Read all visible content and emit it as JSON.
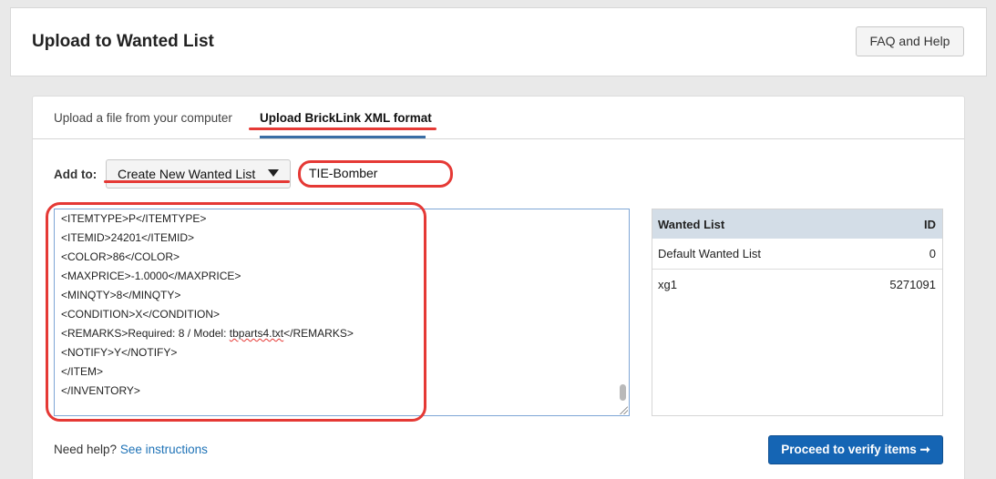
{
  "header": {
    "title": "Upload to Wanted List",
    "faq_label": "FAQ and Help"
  },
  "tabs": [
    {
      "label": "Upload a file from your computer"
    },
    {
      "label": "Upload BrickLink XML format"
    }
  ],
  "add_to": {
    "label": "Add to:",
    "selected": "Create New Wanted List",
    "name_value": "TIE-Bomber"
  },
  "xml_lines": [
    "<ITEMTYPE>P</ITEMTYPE>",
    "<ITEMID>24201</ITEMID>",
    "<COLOR>86</COLOR>",
    "<MAXPRICE>-1.0000</MAXPRICE>",
    "<MINQTY>8</MINQTY>",
    "<CONDITION>X</CONDITION>",
    "<REMARKS>Required: 8 / Model: tbparts4.txt</REMARKS>",
    "<NOTIFY>Y</NOTIFY>",
    "</ITEM>",
    "</INVENTORY>"
  ],
  "xml_remarks": {
    "prefix": "<REMARKS>Required: 8 / Model: ",
    "filename": "tbparts4.txt",
    "suffix": "</REMARKS>"
  },
  "wanted_table": {
    "headers": [
      "Wanted List",
      "ID"
    ],
    "rows": [
      {
        "name": "Default Wanted List",
        "id": "0"
      },
      {
        "name": "xg1",
        "id": "5271091"
      }
    ]
  },
  "footer": {
    "help_prefix": "Need help?",
    "help_link": "See instructions",
    "proceed_label": "Proceed to verify items ➞"
  },
  "colors": {
    "annotation": "#e53935",
    "primary": "#1565b4",
    "link": "#1f73b7",
    "table_header": "#d3dde7"
  }
}
